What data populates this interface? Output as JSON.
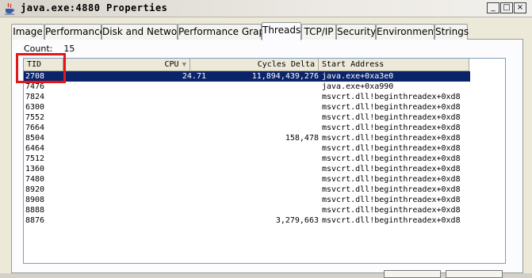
{
  "window": {
    "title": "java.exe:4880 Properties",
    "buttons": {
      "minimize": "_",
      "maximize": "□",
      "close": "×"
    }
  },
  "tabs": [
    {
      "label": "Image"
    },
    {
      "label": "Performance"
    },
    {
      "label": "Disk and Network"
    },
    {
      "label": "Performance Graph"
    },
    {
      "label": "Threads",
      "active": true
    },
    {
      "label": "TCP/IP"
    },
    {
      "label": "Security"
    },
    {
      "label": "Environment"
    },
    {
      "label": "Strings"
    }
  ],
  "threads": {
    "count_label": "Count:",
    "count_value": "15",
    "columns": {
      "tid": "TID",
      "cpu": "CPU",
      "cycles": "Cycles Delta",
      "address": "Start Address"
    },
    "sort_column": "cpu",
    "rows": [
      {
        "tid": "2708",
        "cpu": "24.71",
        "cycles": "11,894,439,276",
        "address": "java.exe+0xa3e0",
        "selected": true
      },
      {
        "tid": "7476",
        "cpu": "",
        "cycles": "",
        "address": "java.exe+0xa990"
      },
      {
        "tid": "7824",
        "cpu": "",
        "cycles": "",
        "address": "msvcrt.dll!beginthreadex+0xd8"
      },
      {
        "tid": "6300",
        "cpu": "",
        "cycles": "",
        "address": "msvcrt.dll!beginthreadex+0xd8"
      },
      {
        "tid": "7552",
        "cpu": "",
        "cycles": "",
        "address": "msvcrt.dll!beginthreadex+0xd8"
      },
      {
        "tid": "7664",
        "cpu": "",
        "cycles": "",
        "address": "msvcrt.dll!beginthreadex+0xd8"
      },
      {
        "tid": "8504",
        "cpu": "",
        "cycles": "158,478",
        "address": "msvcrt.dll!beginthreadex+0xd8"
      },
      {
        "tid": "6464",
        "cpu": "",
        "cycles": "",
        "address": "msvcrt.dll!beginthreadex+0xd8"
      },
      {
        "tid": "7512",
        "cpu": "",
        "cycles": "",
        "address": "msvcrt.dll!beginthreadex+0xd8"
      },
      {
        "tid": "1360",
        "cpu": "",
        "cycles": "",
        "address": "msvcrt.dll!beginthreadex+0xd8"
      },
      {
        "tid": "7480",
        "cpu": "",
        "cycles": "",
        "address": "msvcrt.dll!beginthreadex+0xd8"
      },
      {
        "tid": "8920",
        "cpu": "",
        "cycles": "",
        "address": "msvcrt.dll!beginthreadex+0xd8"
      },
      {
        "tid": "8908",
        "cpu": "",
        "cycles": "",
        "address": "msvcrt.dll!beginthreadex+0xd8"
      },
      {
        "tid": "8888",
        "cpu": "",
        "cycles": "",
        "address": "msvcrt.dll!beginthreadex+0xd8"
      },
      {
        "tid": "8876",
        "cpu": "",
        "cycles": "3,279,663",
        "address": "msvcrt.dll!beginthreadex+0xd8"
      }
    ]
  },
  "colors": {
    "selection": "#0a246a",
    "highlight_box": "#e01818"
  },
  "icons": {
    "title": "java-cup-icon",
    "sort": "sort-descending-icon"
  }
}
